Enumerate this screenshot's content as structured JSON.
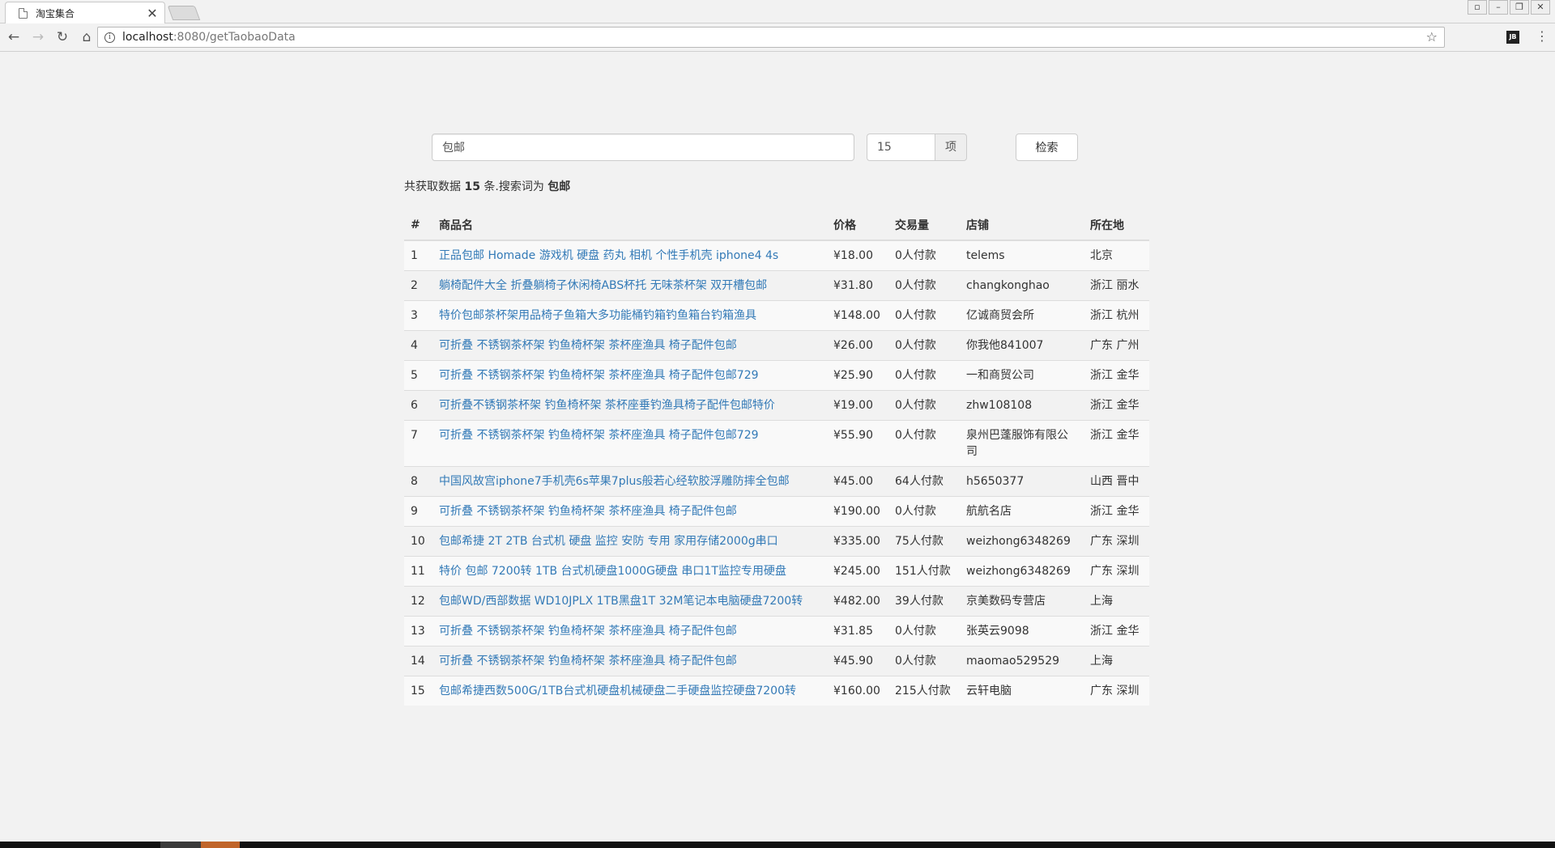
{
  "browser": {
    "tab_title": "淘宝集合",
    "tab_close": "✕",
    "url_host": "localhost",
    "url_path": ":8080/getTaobaoData"
  },
  "search": {
    "keyword_value": "包邮",
    "count_value": "15",
    "count_unit": "项",
    "button_label": "检索"
  },
  "summary": {
    "prefix": "共获取数据",
    "count": "15",
    "middle": "条.搜索词为",
    "keyword": "包邮"
  },
  "table": {
    "headers": [
      "#",
      "商品名",
      "价格",
      "交易量",
      "店铺",
      "所在地"
    ],
    "rows": [
      {
        "idx": "1",
        "title": "正品包邮 Homade 游戏机 硬盘 药丸 相机 个性手机壳 iphone4 4s",
        "price": "¥18.00",
        "sales": "0人付款",
        "shop": "telems",
        "location": "北京"
      },
      {
        "idx": "2",
        "title": "躺椅配件大全 折叠躺椅子休闲椅ABS杯托 无味茶杯架 双开槽包邮",
        "price": "¥31.80",
        "sales": "0人付款",
        "shop": "changkonghao",
        "location": "浙江 丽水"
      },
      {
        "idx": "3",
        "title": "特价包邮茶杯架用品椅子鱼箱大多功能桶钓箱钓鱼箱台钓箱渔具",
        "price": "¥148.00",
        "sales": "0人付款",
        "shop": "亿诚商贸会所",
        "location": "浙江 杭州"
      },
      {
        "idx": "4",
        "title": "可折叠 不锈钢茶杯架 钓鱼椅杯架 茶杯座渔具 椅子配件包邮",
        "price": "¥26.00",
        "sales": "0人付款",
        "shop": "你我他841007",
        "location": "广东 广州"
      },
      {
        "idx": "5",
        "title": "可折叠 不锈钢茶杯架 钓鱼椅杯架 茶杯座渔具 椅子配件包邮729",
        "price": "¥25.90",
        "sales": "0人付款",
        "shop": "一和商贸公司",
        "location": "浙江 金华"
      },
      {
        "idx": "6",
        "title": "可折叠不锈钢茶杯架 钓鱼椅杯架 茶杯座垂钓渔具椅子配件包邮特价",
        "price": "¥19.00",
        "sales": "0人付款",
        "shop": "zhw108108",
        "location": "浙江 金华"
      },
      {
        "idx": "7",
        "title": "可折叠 不锈钢茶杯架 钓鱼椅杯架 茶杯座渔具 椅子配件包邮729",
        "price": "¥55.90",
        "sales": "0人付款",
        "shop": "泉州巴蓬服饰有限公司",
        "location": "浙江 金华"
      },
      {
        "idx": "8",
        "title": "中国风故宫iphone7手机壳6s苹果7plus般若心经软胶浮雕防摔全包邮",
        "price": "¥45.00",
        "sales": "64人付款",
        "shop": "h5650377",
        "location": "山西 晋中"
      },
      {
        "idx": "9",
        "title": "可折叠 不锈钢茶杯架 钓鱼椅杯架 茶杯座渔具 椅子配件包邮",
        "price": "¥190.00",
        "sales": "0人付款",
        "shop": "航航名店",
        "location": "浙江 金华"
      },
      {
        "idx": "10",
        "title": "包邮希捷 2T 2TB 台式机 硬盘 监控 安防 专用 家用存储2000g串口",
        "price": "¥335.00",
        "sales": "75人付款",
        "shop": "weizhong6348269",
        "location": "广东 深圳"
      },
      {
        "idx": "11",
        "title": "特价 包邮 7200转 1TB 台式机硬盘1000G硬盘 串口1T监控专用硬盘",
        "price": "¥245.00",
        "sales": "151人付款",
        "shop": "weizhong6348269",
        "location": "广东 深圳"
      },
      {
        "idx": "12",
        "title": "包邮WD/西部数据 WD10JPLX 1TB黑盘1T 32M笔记本电脑硬盘7200转",
        "price": "¥482.00",
        "sales": "39人付款",
        "shop": "京美数码专营店",
        "location": "上海"
      },
      {
        "idx": "13",
        "title": "可折叠 不锈钢茶杯架 钓鱼椅杯架 茶杯座渔具 椅子配件包邮",
        "price": "¥31.85",
        "sales": "0人付款",
        "shop": "张英云9098",
        "location": "浙江 金华"
      },
      {
        "idx": "14",
        "title": "可折叠 不锈钢茶杯架 钓鱼椅杯架 茶杯座渔具 椅子配件包邮",
        "price": "¥45.90",
        "sales": "0人付款",
        "shop": "maomao529529",
        "location": "上海"
      },
      {
        "idx": "15",
        "title": "包邮希捷西数500G/1TB台式机硬盘机械硬盘二手硬盘监控硬盘7200转",
        "price": "¥160.00",
        "sales": "215人付款",
        "shop": "云轩电脑",
        "location": "广东 深圳"
      }
    ]
  },
  "colors": {
    "link": "#337ab7",
    "page_bg": "#f2f2f2",
    "stripe": "#f9f9f9"
  }
}
